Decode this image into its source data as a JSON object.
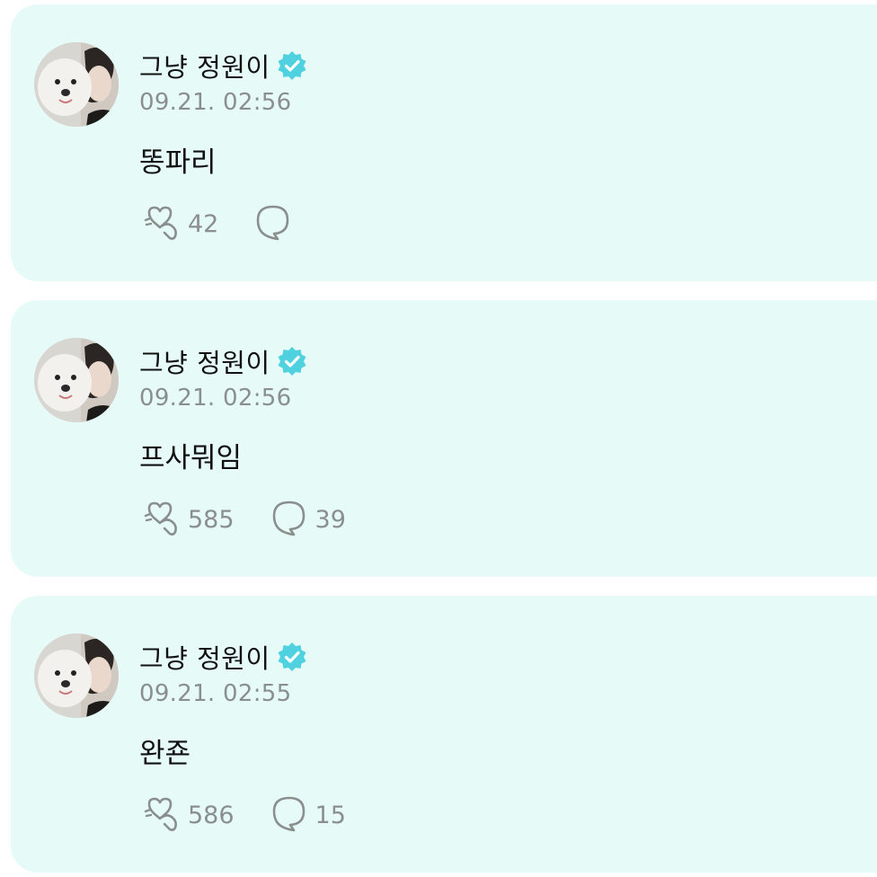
{
  "posts": [
    {
      "author": "그냥 정원이",
      "time": "09.21. 02:56",
      "text": "똥파리",
      "likes": "42",
      "comments": ""
    },
    {
      "author": "그냥 정원이",
      "time": "09.21. 02:56",
      "text": "프사뭐임",
      "likes": "585",
      "comments": "39"
    },
    {
      "author": "그냥 정원이",
      "time": "09.21. 02:55",
      "text": "완죤",
      "likes": "586",
      "comments": "15"
    }
  ],
  "icons": {
    "avatar": "profile-photo-dog-and-person",
    "verified": "verified-badge-icon",
    "like": "heart-hand-icon",
    "comment": "speech-bubble-icon"
  },
  "colors": {
    "card_bg": "#e6fbf7",
    "verified": "#4fd1e0",
    "muted": "#8a8f8e",
    "text": "#111111"
  }
}
